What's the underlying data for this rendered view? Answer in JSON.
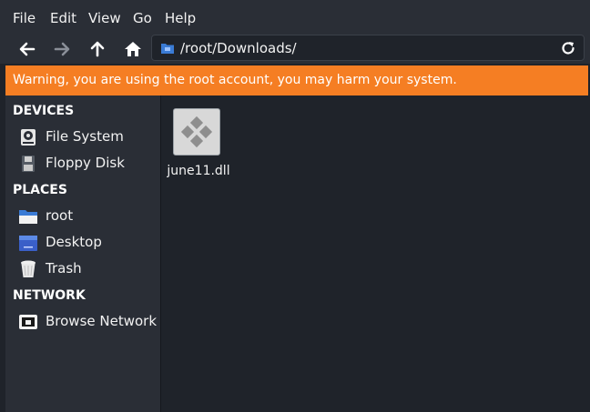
{
  "menu": {
    "file": "File",
    "edit": "Edit",
    "view": "View",
    "go": "Go",
    "help": "Help"
  },
  "toolbar": {
    "back_icon": "arrow-left-icon",
    "forward_icon": "arrow-right-icon",
    "up_icon": "arrow-up-icon",
    "home_icon": "home-icon",
    "reload_icon": "reload-icon",
    "location": "/root/Downloads/"
  },
  "warning": {
    "text": "Warning, you are using the root account, you may harm your system.",
    "color": "#f57e23"
  },
  "sidebar": {
    "devices_title": "DEVICES",
    "places_title": "PLACES",
    "network_title": "NETWORK",
    "devices": [
      {
        "label": "File System",
        "icon": "drive-icon"
      },
      {
        "label": "Floppy Disk",
        "icon": "floppy-icon"
      }
    ],
    "places": [
      {
        "label": "root",
        "icon": "folder-home-icon"
      },
      {
        "label": "Desktop",
        "icon": "desktop-icon"
      },
      {
        "label": "Trash",
        "icon": "trash-icon"
      }
    ],
    "network": [
      {
        "label": "Browse Network",
        "icon": "network-icon"
      }
    ]
  },
  "files": [
    {
      "name": "june11.dll",
      "icon": "dll-file-icon"
    }
  ],
  "colors": {
    "background": "#1f232a",
    "panel": "#2a2e36",
    "accent_blue": "#3a7bd5"
  }
}
